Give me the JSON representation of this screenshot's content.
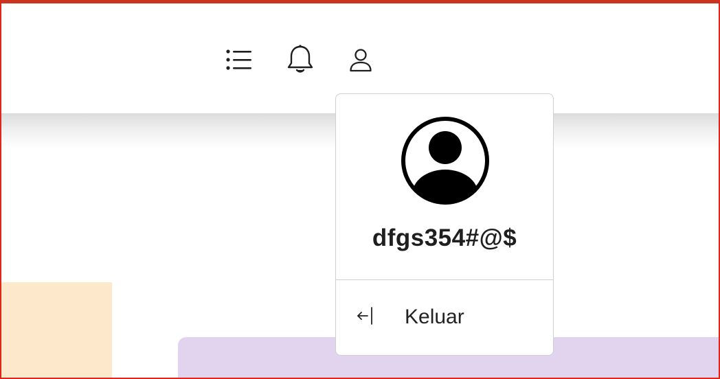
{
  "header": {
    "icons": {
      "menu": "list-icon",
      "notifications": "bell-icon",
      "profile": "user-icon"
    }
  },
  "profile_menu": {
    "avatar_icon": "person-circle-icon",
    "username": "dfgs354#@$",
    "logout": {
      "icon": "logout-arrow-icon",
      "label": "Keluar"
    }
  },
  "colors": {
    "frame_border": "#e0261b",
    "peach_panel": "#fde8cc",
    "lavender_panel": "#e2d4ef",
    "icon_stroke": "#1e1e1e"
  }
}
